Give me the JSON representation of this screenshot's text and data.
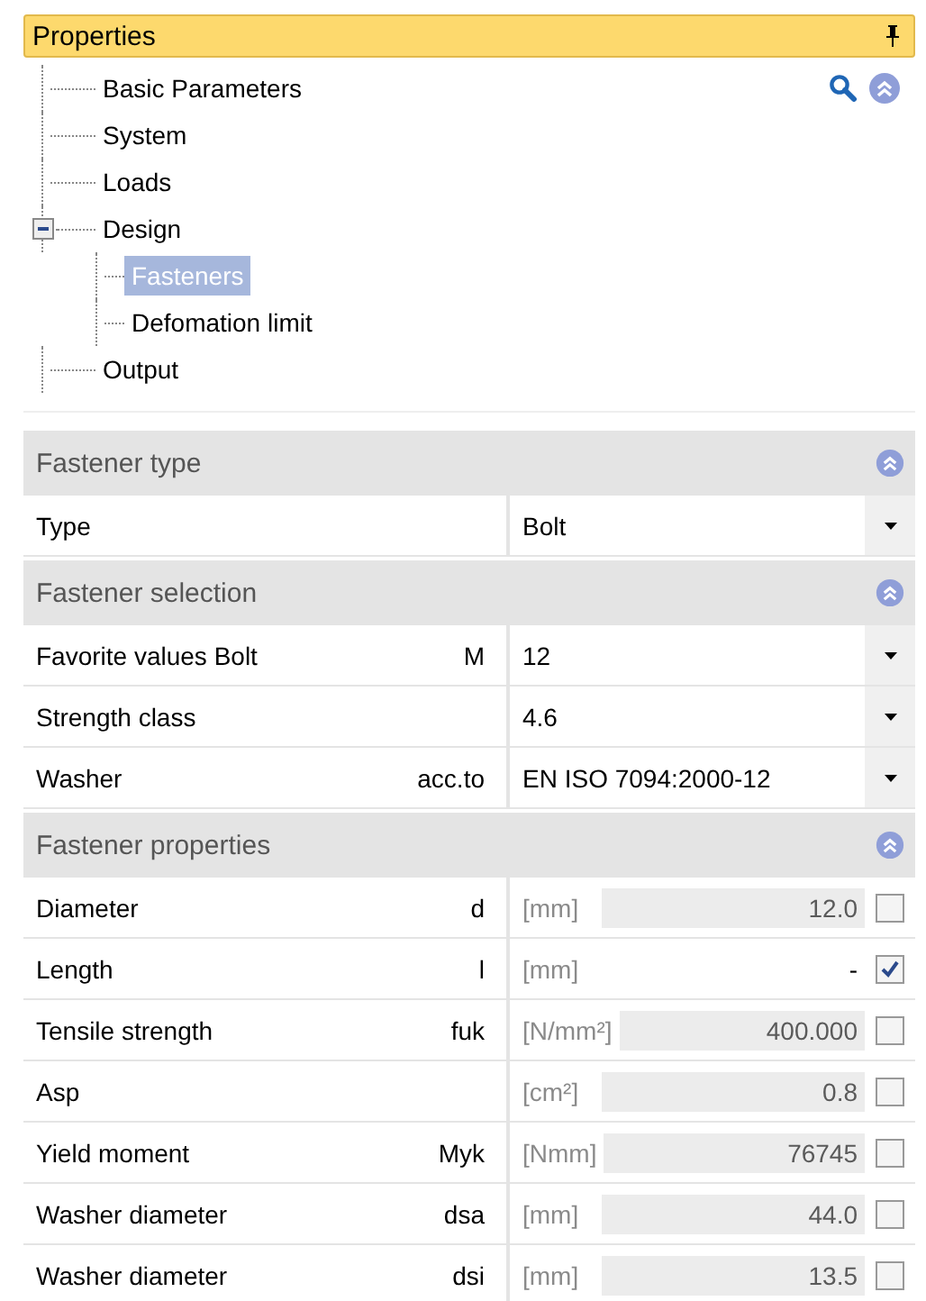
{
  "panel": {
    "title": "Properties"
  },
  "tree": [
    {
      "label": "Basic Parameters",
      "selected": false
    },
    {
      "label": "System",
      "selected": false
    },
    {
      "label": "Loads",
      "selected": false
    },
    {
      "label": "Design",
      "selected": false,
      "expanded": true,
      "children": [
        {
          "label": "Fasteners",
          "selected": true
        },
        {
          "label": "Defomation limit",
          "selected": false
        }
      ]
    },
    {
      "label": "Output",
      "selected": false
    }
  ],
  "sections": [
    {
      "title": "Fastener type",
      "rows": [
        {
          "kind": "dropdown",
          "label": "Type",
          "value": "Bolt"
        }
      ]
    },
    {
      "title": "Fastener selection",
      "rows": [
        {
          "kind": "dropdown",
          "label": "Favorite values Bolt",
          "symbol": "M",
          "value": "12"
        },
        {
          "kind": "dropdown",
          "label": "Strength class",
          "value": "4.6"
        },
        {
          "kind": "dropdown",
          "label": "Washer",
          "symbol": "acc.to",
          "value": "EN ISO 7094:2000-12"
        }
      ]
    },
    {
      "title": "Fastener properties",
      "rows": [
        {
          "kind": "value",
          "label": "Diameter",
          "symbol": "d",
          "unit": "[mm]",
          "value": "12.0",
          "checked": false
        },
        {
          "kind": "value",
          "label": "Length",
          "symbol": "l",
          "unit": "[mm]",
          "value": "-",
          "checked": true
        },
        {
          "kind": "value",
          "label": "Tensile strength",
          "symbol": "fuk",
          "unit": "[N/mm²]",
          "value": "400.000",
          "checked": false
        },
        {
          "kind": "value",
          "label": "Asp",
          "unit": "[cm²]",
          "value": "0.8",
          "checked": false
        },
        {
          "kind": "value",
          "label": "Yield moment",
          "symbol": "Myk",
          "unit": "[Nmm]",
          "value": "76745",
          "checked": false
        },
        {
          "kind": "value",
          "label": "Washer diameter",
          "symbol": "dsa",
          "unit": "[mm]",
          "value": "44.0",
          "checked": false
        },
        {
          "kind": "value",
          "label": "Washer diameter",
          "symbol": "dsi",
          "unit": "[mm]",
          "value": "13.5",
          "checked": false
        }
      ]
    }
  ]
}
